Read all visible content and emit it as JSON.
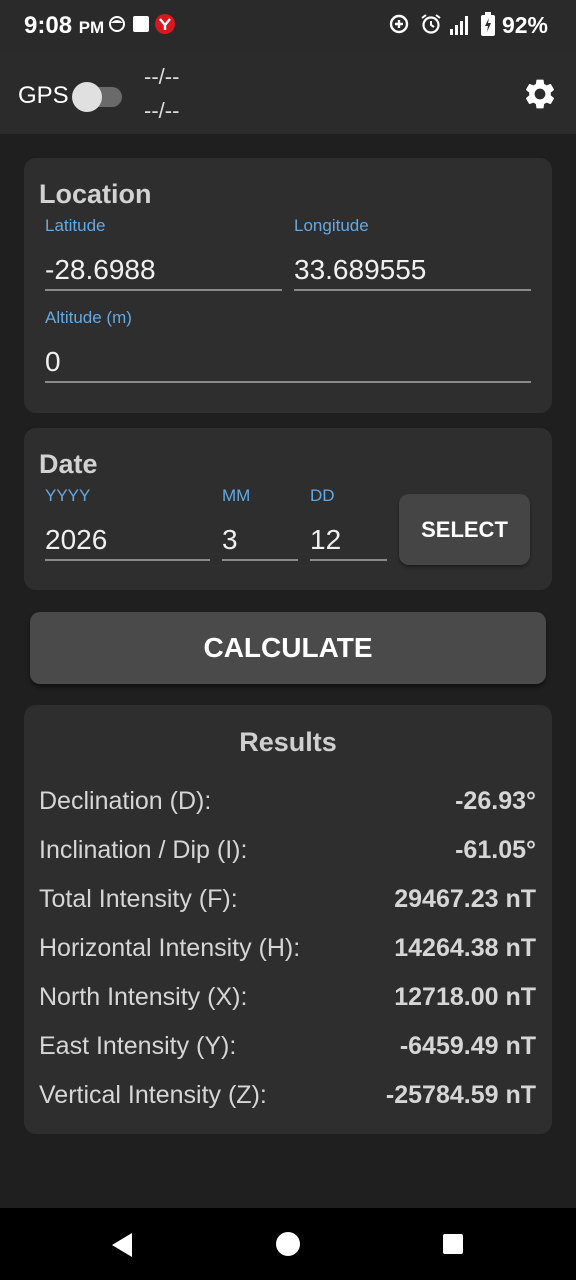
{
  "status_bar": {
    "time": "9:08",
    "ampm": "PM",
    "battery": "92%"
  },
  "top_bar": {
    "gps_label": "GPS",
    "gps_line1": "--/--",
    "gps_line2": "--/--",
    "gps_enabled": false
  },
  "location": {
    "title": "Location",
    "latitude_label": "Latitude",
    "latitude_value": "-28.6988",
    "longitude_label": "Longitude",
    "longitude_value": "33.689555",
    "altitude_label": "Altitude (m)",
    "altitude_value": "0"
  },
  "date": {
    "title": "Date",
    "year_label": "YYYY",
    "year_value": "2026",
    "month_label": "MM",
    "month_value": "3",
    "day_label": "DD",
    "day_value": "12",
    "select_label": "SELECT"
  },
  "calculate_label": "CALCULATE",
  "results": {
    "title": "Results",
    "rows": [
      {
        "label": "Declination (D):",
        "value": "-26.93°"
      },
      {
        "label": "Inclination / Dip (I):",
        "value": "-61.05°"
      },
      {
        "label": "Total Intensity (F):",
        "value": "29467.23 nT"
      },
      {
        "label": "Horizontal Intensity (H):",
        "value": "14264.38 nT"
      },
      {
        "label": "North Intensity (X):",
        "value": "12718.00 nT"
      },
      {
        "label": "East Intensity (Y):",
        "value": "-6459.49 nT"
      },
      {
        "label": "Vertical Intensity (Z):",
        "value": "-25784.59 nT"
      }
    ]
  },
  "icons": [
    "settings-gear-icon",
    "back-icon",
    "home-icon",
    "recents-icon"
  ],
  "colors": {
    "accent_label": "#64a9e2",
    "background": "#1f1f1f",
    "card": "#2e2e2e"
  }
}
